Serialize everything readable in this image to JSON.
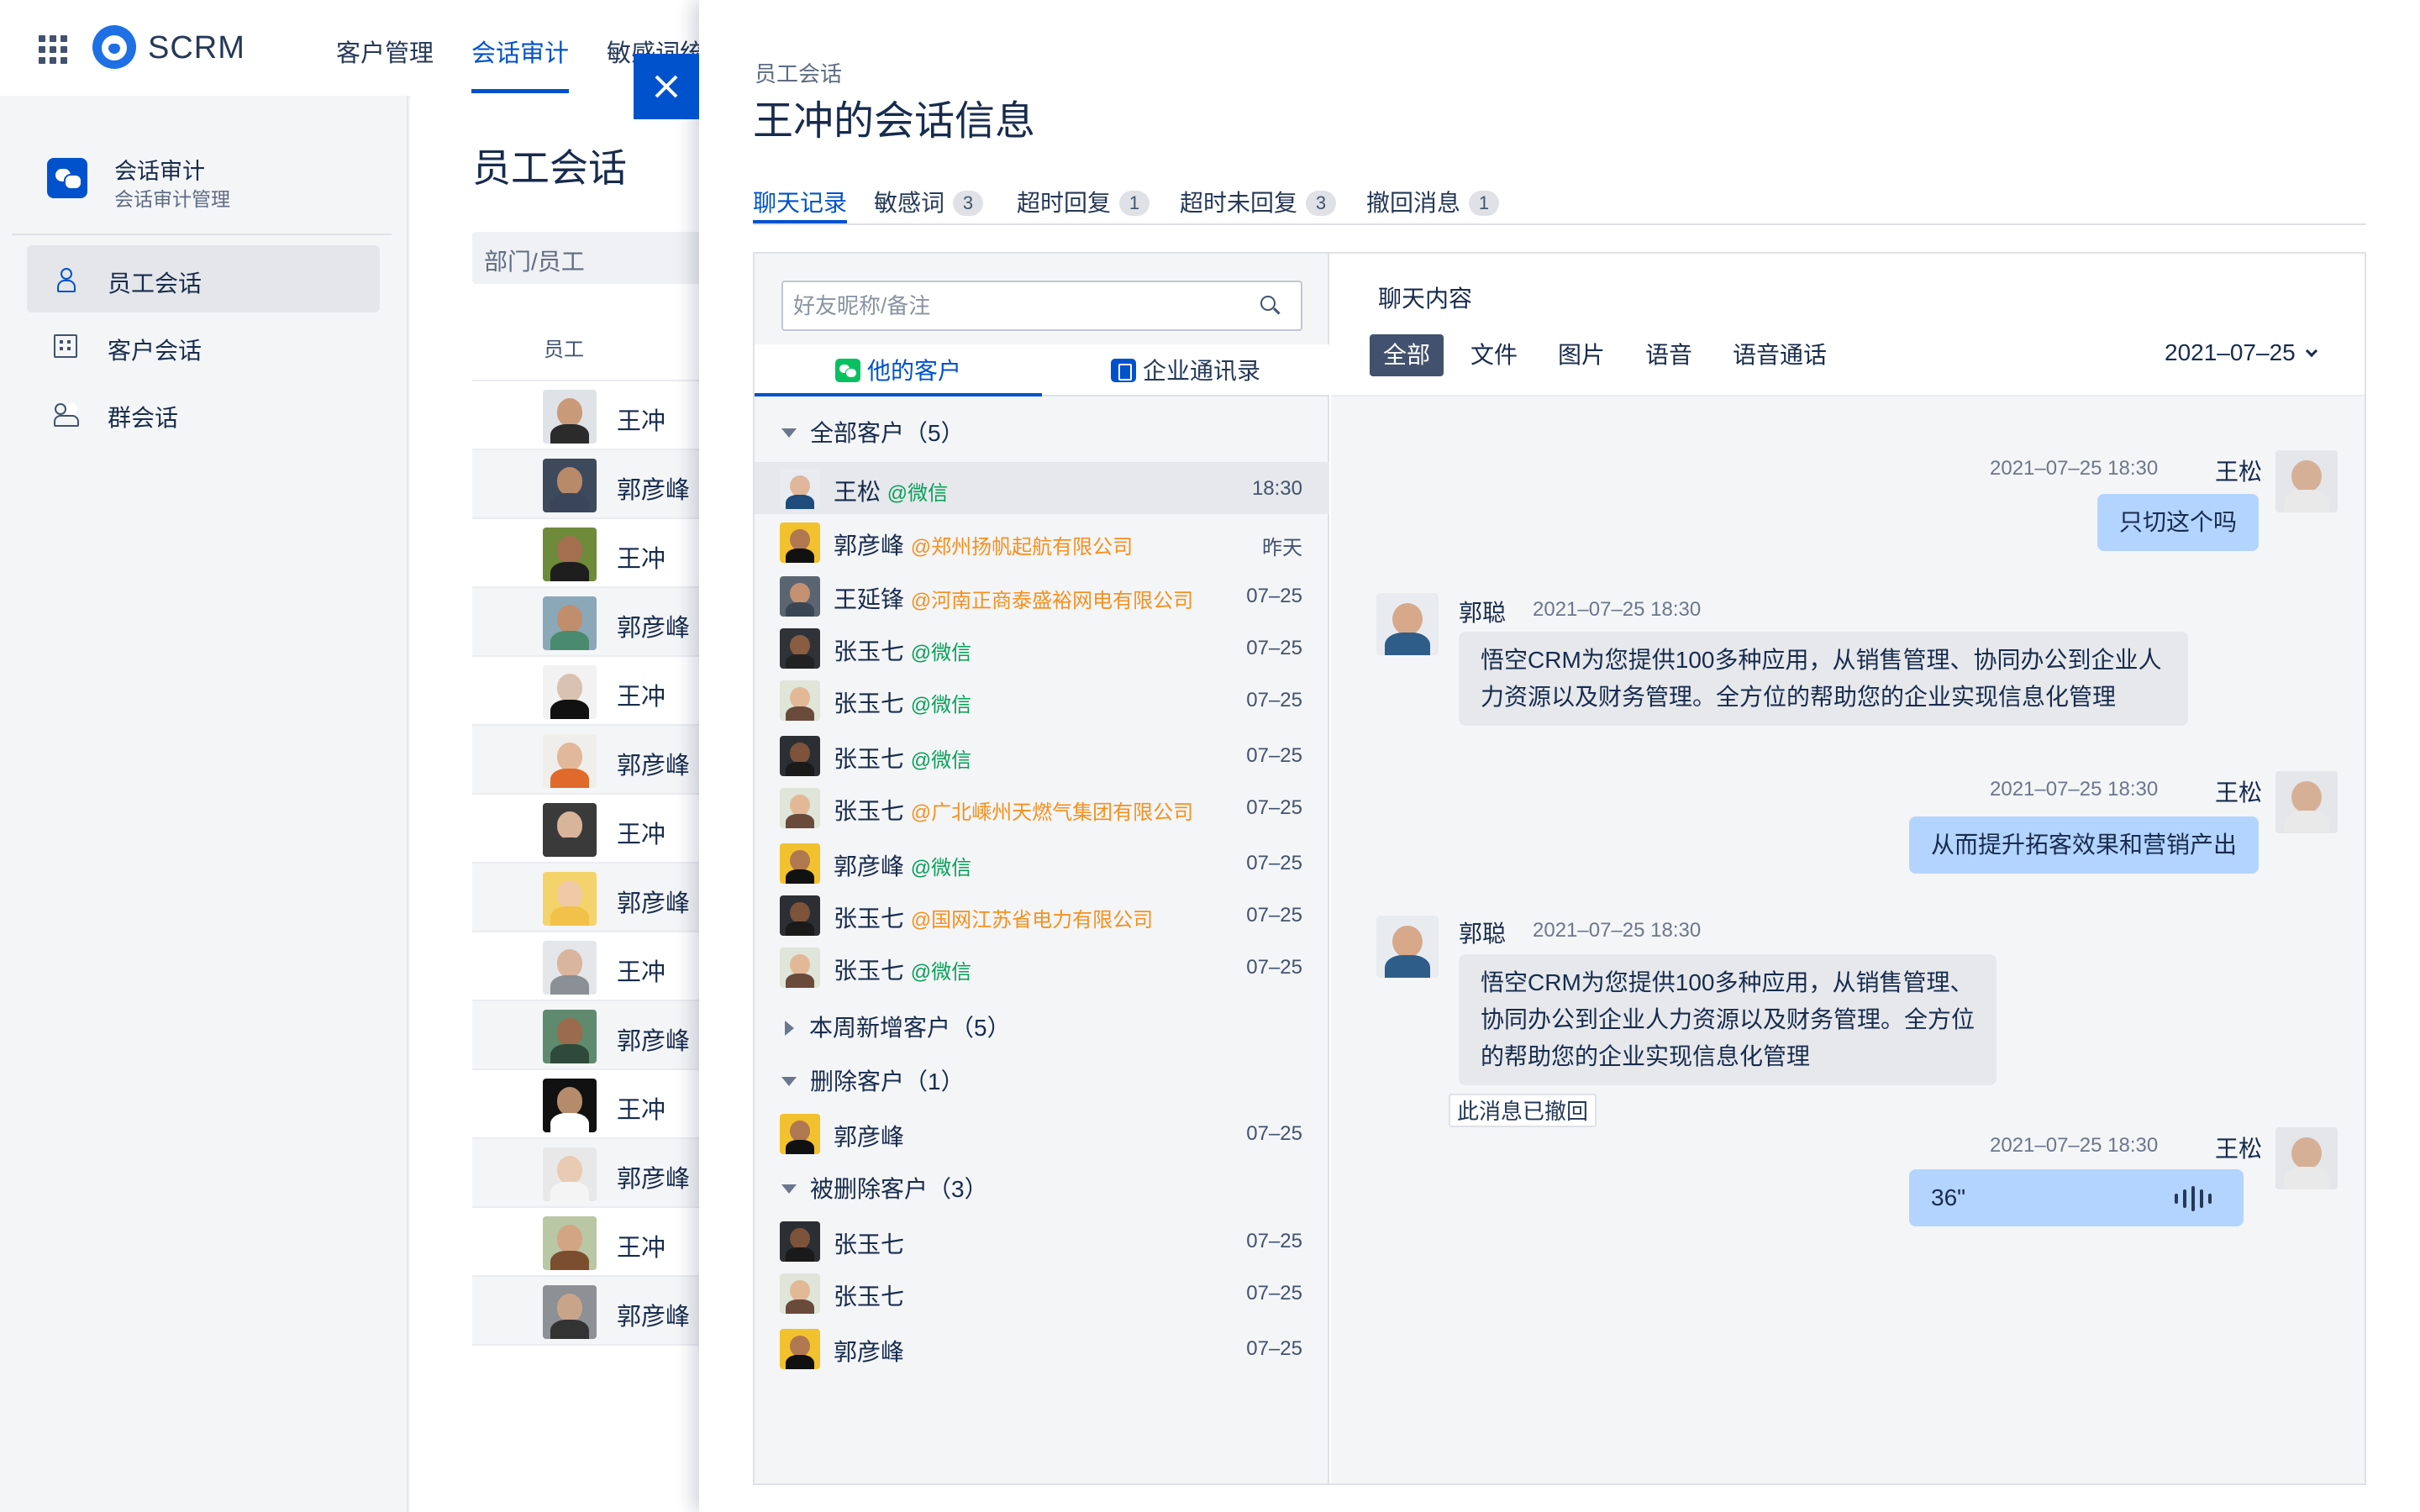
{
  "app": {
    "name": "SCRM"
  },
  "topnav": {
    "items": [
      "客户管理",
      "会话审计",
      "敏感词统"
    ]
  },
  "sidebar": {
    "title": "会话审计",
    "subtitle": "会话审计管理",
    "items": [
      {
        "label": "员工会话",
        "icon": "user-icon",
        "active": true
      },
      {
        "label": "客户会话",
        "icon": "building-icon",
        "active": false
      },
      {
        "label": "群会话",
        "icon": "group-icon",
        "active": false
      }
    ]
  },
  "background": {
    "title": "员工会话",
    "filter_placeholder": "部门/员工",
    "column_header": "员工",
    "rows": [
      "王冲",
      "郭彦峰",
      "王冲",
      "郭彦峰",
      "王冲",
      "郭彦峰",
      "王冲",
      "郭彦峰",
      "王冲",
      "郭彦峰",
      "王冲",
      "郭彦峰",
      "王冲",
      "郭彦峰"
    ]
  },
  "panel": {
    "breadcrumb": "员工会话",
    "title": "王冲的会话信息",
    "tabs": [
      {
        "label": "聊天记录",
        "count": ""
      },
      {
        "label": "敏感词",
        "count": "3"
      },
      {
        "label": "超时回复",
        "count": "1"
      },
      {
        "label": "超时未回复",
        "count": "3"
      },
      {
        "label": "撤回消息",
        "count": "1"
      }
    ],
    "search_placeholder": "好友昵称/备注",
    "subtabs": [
      "他的客户",
      "企业通讯录"
    ],
    "groups": {
      "all": "全部客户（5）",
      "week": "本周新增客户（5）",
      "deleted": "删除客户（1）",
      "deleted_by": "被删除客户（3）"
    },
    "contacts": [
      {
        "name": "王松",
        "org": "@微信",
        "org_type": "wx",
        "time": "18:30"
      },
      {
        "name": "郭彦峰",
        "org": "@郑州扬帆起航有限公司",
        "org_type": "co",
        "time": "昨天"
      },
      {
        "name": "王延锋",
        "org": "@河南正商泰盛裕网电有限公司",
        "org_type": "co",
        "time": "07–25"
      },
      {
        "name": "张玉七",
        "org": "@微信",
        "org_type": "wx",
        "time": "07–25"
      },
      {
        "name": "张玉七",
        "org": "@微信",
        "org_type": "wx",
        "time": "07–25"
      },
      {
        "name": "张玉七",
        "org": "@微信",
        "org_type": "wx",
        "time": "07–25"
      },
      {
        "name": "张玉七",
        "org": "@广北嵊州天燃气集团有限公司",
        "org_type": "co",
        "time": "07–25"
      },
      {
        "name": "郭彦峰",
        "org": "@微信",
        "org_type": "wx",
        "time": "07–25"
      },
      {
        "name": "张玉七",
        "org": "@国网江苏省电力有限公司",
        "org_type": "co",
        "time": "07–25"
      },
      {
        "name": "张玉七",
        "org": "@微信",
        "org_type": "wx",
        "time": "07–25"
      }
    ],
    "deleted_contacts": [
      {
        "name": "郭彦峰",
        "time": "07–25"
      }
    ],
    "deleted_by_contacts": [
      {
        "name": "张玉七",
        "time": "07–25"
      },
      {
        "name": "张玉七",
        "time": "07–25"
      },
      {
        "name": "郭彦峰",
        "time": "07–25"
      }
    ],
    "chat": {
      "title": "聊天内容",
      "filters": [
        "全部",
        "文件",
        "图片",
        "语音",
        "语音通话"
      ],
      "date": "2021–07–25",
      "messages": [
        {
          "dir": "out",
          "name": "王松",
          "time": "2021–07–25  18:30",
          "text": "只切这个吗"
        },
        {
          "dir": "in",
          "name": "郭聪",
          "time": "2021–07–25  18:30",
          "lines": [
            "悟空CRM为您提供100多种应用，从销售管理、协同办公到企业人",
            "力资源以及财务管理。全方位的帮助您的企业实现信息化管理"
          ]
        },
        {
          "dir": "out",
          "name": "王松",
          "time": "2021–07–25  18:30",
          "text": "从而提升拓客效果和营销产出"
        },
        {
          "dir": "in",
          "name": "郭聪",
          "time": "2021–07–25  18:30",
          "lines": [
            "悟空CRM为您提供100多种应用，从销售管理、",
            "协同办公到企业人力资源以及财务管理。全方位",
            "的帮助您的企业实现信息化管理"
          ],
          "recalled": "此消息已撤回"
        },
        {
          "dir": "out",
          "name": "王松",
          "time": "2021–07–25  18:30",
          "voice": "36\""
        }
      ]
    }
  },
  "colors": {
    "primary": "#0052cc",
    "wechat": "#07c160",
    "company": "#f5901e",
    "bubble_out": "#b3d4ff"
  }
}
